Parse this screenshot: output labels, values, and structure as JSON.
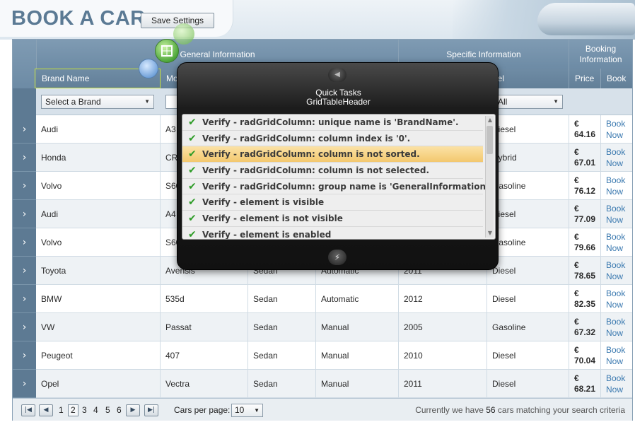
{
  "app": {
    "title": "BOOK A CAR",
    "save_settings": "Save Settings"
  },
  "grid": {
    "group_headers": {
      "general": "General Information",
      "specific": "Specific Information",
      "booking": "Booking Information"
    },
    "columns": {
      "brand": "Brand Name",
      "model": "Mo",
      "fuel": "uel",
      "price": "Price",
      "book": "Book"
    },
    "filters": {
      "brand_placeholder": "Select a Brand",
      "fuel_value": "All"
    },
    "rows": [
      {
        "brand": "Audi",
        "model": "A3",
        "type": "",
        "transmission": "",
        "year": "",
        "fuel": "Diesel",
        "price_symbol": "€",
        "price": "64.16",
        "book_1": "Book",
        "book_2": "Now"
      },
      {
        "brand": "Honda",
        "model": "CR-",
        "type": "",
        "transmission": "",
        "year": "",
        "fuel": "Hybrid",
        "price_symbol": "€",
        "price": "67.01",
        "book_1": "Book",
        "book_2": "Now"
      },
      {
        "brand": "Volvo",
        "model": "S60",
        "type": "",
        "transmission": "",
        "year": "",
        "fuel": "Gasoline",
        "price_symbol": "€",
        "price": "76.12",
        "book_1": "Book",
        "book_2": "Now"
      },
      {
        "brand": "Audi",
        "model": "A4",
        "type": "",
        "transmission": "",
        "year": "",
        "fuel": "Diesel",
        "price_symbol": "€",
        "price": "77.09",
        "book_1": "Book",
        "book_2": "Now"
      },
      {
        "brand": "Volvo",
        "model": "S60",
        "type": "",
        "transmission": "",
        "year": "",
        "fuel": "Gasoline",
        "price_symbol": "€",
        "price": "79.66",
        "book_1": "Book",
        "book_2": "Now"
      },
      {
        "brand": "Toyota",
        "model": "Avensis",
        "type": "Sedan",
        "transmission": "Automatic",
        "year": "2011",
        "fuel": "Diesel",
        "price_symbol": "€",
        "price": "78.65",
        "book_1": "Book",
        "book_2": "Now"
      },
      {
        "brand": "BMW",
        "model": "535d",
        "type": "Sedan",
        "transmission": "Automatic",
        "year": "2012",
        "fuel": "Diesel",
        "price_symbol": "€",
        "price": "82.35",
        "book_1": "Book",
        "book_2": "Now"
      },
      {
        "brand": "VW",
        "model": "Passat",
        "type": "Sedan",
        "transmission": "Manual",
        "year": "2005",
        "fuel": "Gasoline",
        "price_symbol": "€",
        "price": "67.32",
        "book_1": "Book",
        "book_2": "Now"
      },
      {
        "brand": "Peugeot",
        "model": "407",
        "type": "Sedan",
        "transmission": "Manual",
        "year": "2010",
        "fuel": "Diesel",
        "price_symbol": "€",
        "price": "70.04",
        "book_1": "Book",
        "book_2": "Now"
      },
      {
        "brand": "Opel",
        "model": "Vectra",
        "type": "Sedan",
        "transmission": "Manual",
        "year": "2011",
        "fuel": "Diesel",
        "price_symbol": "€",
        "price": "68.21",
        "book_1": "Book",
        "book_2": "Now"
      }
    ]
  },
  "pager": {
    "pages": [
      "1",
      "2",
      "3",
      "4",
      "5",
      "6"
    ],
    "current_page": "2",
    "cars_per_page_label": "Cars per page:",
    "cars_per_page_value": "10",
    "status_prefix": "Currently we have ",
    "status_count": "56",
    "status_suffix": " cars matching your search criteria"
  },
  "quick_tasks": {
    "title_line1": "Quick Tasks",
    "title_line2": "GridTableHeader",
    "items": [
      {
        "label": "Verify - radGridColumn: unique name is 'BrandName'.",
        "highlighted": false
      },
      {
        "label": "Verify - radGridColumn: column index is '0'.",
        "highlighted": false
      },
      {
        "label": "Verify - radGridColumn: column is not sorted.",
        "highlighted": true
      },
      {
        "label": "Verify - radGridColumn: column is not selected.",
        "highlighted": false
      },
      {
        "label": "Verify - radGridColumn: group name is 'GeneralInformation'.",
        "highlighted": false
      },
      {
        "label": "Verify - element is visible",
        "highlighted": false
      },
      {
        "label": "Verify - element is not visible",
        "highlighted": false
      },
      {
        "label": "Verify - element is enabled",
        "highlighted": false
      }
    ]
  },
  "icons": {
    "row_expander": "chevron-right-icon",
    "check": "checkmark-icon",
    "back": "back-arrow-icon",
    "bolt": "lightning-icon",
    "grid_adorner": "table-icon"
  },
  "colors": {
    "title": "#5b7a94",
    "header": "#6f8ca5",
    "highlight": "#f3c86e",
    "check": "#2e9c27",
    "link": "#3c7ab0"
  }
}
